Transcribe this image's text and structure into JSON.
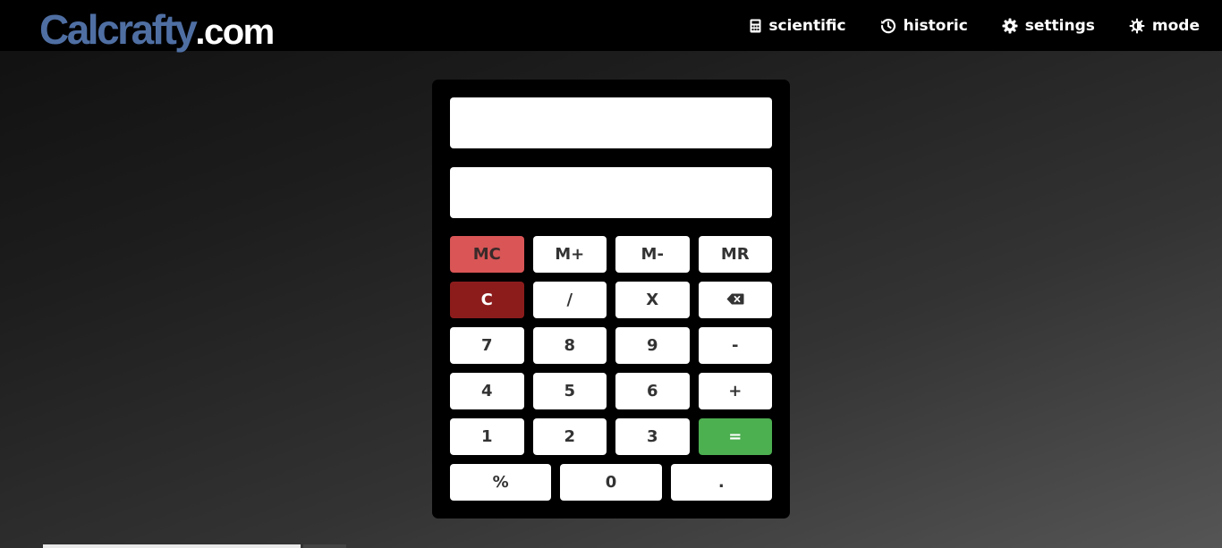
{
  "header": {
    "logo_main": "Calcrafty",
    "logo_tld": ".com",
    "nav": [
      {
        "label": "scientific",
        "icon": "calculator-icon"
      },
      {
        "label": "historic",
        "icon": "history-icon"
      },
      {
        "label": "settings",
        "icon": "gear-icon"
      },
      {
        "label": "mode",
        "icon": "brightness-icon"
      }
    ]
  },
  "calculator": {
    "display_expression": "",
    "display_result": "",
    "keys": {
      "mc": "MC",
      "m_plus": "M+",
      "m_minus": "M-",
      "mr": "MR",
      "clear": "C",
      "divide": "/",
      "multiply": "X",
      "backspace_icon": "backspace-icon",
      "seven": "7",
      "eight": "8",
      "nine": "9",
      "minus": "-",
      "four": "4",
      "five": "5",
      "six": "6",
      "plus": "+",
      "one": "1",
      "two": "2",
      "three": "3",
      "equals": "=",
      "percent": "%",
      "zero": "0",
      "decimal": "."
    }
  },
  "colors": {
    "logo_blue": "#4f6fa3",
    "mc_key": "#d95556",
    "clear_key": "#8c1c1c",
    "equals_key": "#4caf50"
  }
}
